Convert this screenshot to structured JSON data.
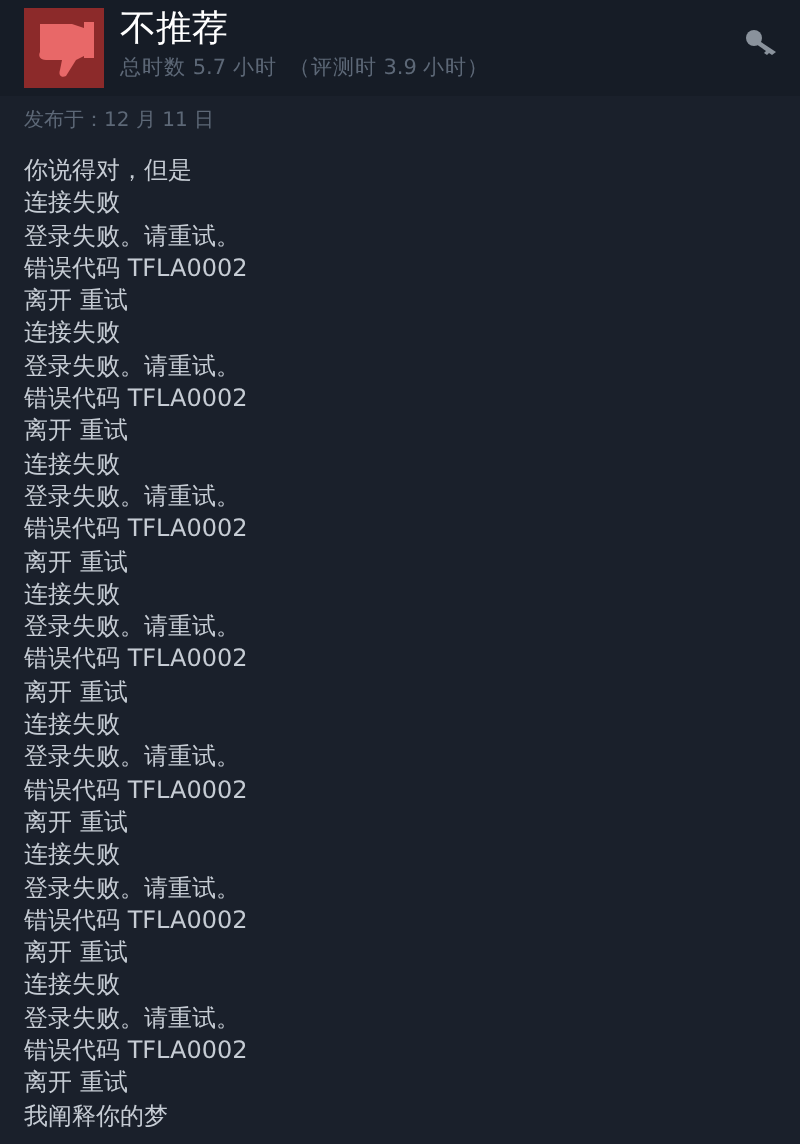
{
  "header": {
    "verdict": "不推荐",
    "hours": "总时数 5.7 小时",
    "hours_at_review": "（评测时 3.9 小时）"
  },
  "posted": "发布于：12 月 11 日",
  "lines": [
    "你说得对，但是",
    "连接失败",
    "登录失败。请重试。",
    "错误代码 TFLA0002",
    "离开 重试",
    "连接失败",
    "登录失败。请重试。",
    "错误代码 TFLA0002",
    "离开 重试",
    "连接失败",
    "登录失败。请重试。",
    "错误代码 TFLA0002",
    "离开 重试",
    "连接失败",
    "登录失败。请重试。",
    "错误代码 TFLA0002",
    "离开 重试",
    "连接失败",
    "登录失败。请重试。",
    "错误代码 TFLA0002",
    "离开 重试",
    "连接失败",
    "登录失败。请重试。",
    "错误代码 TFLA0002",
    "离开 重试",
    "连接失败",
    "登录失败。请重试。",
    "错误代码 TFLA0002",
    "离开 重试",
    "我阐释你的梦"
  ]
}
